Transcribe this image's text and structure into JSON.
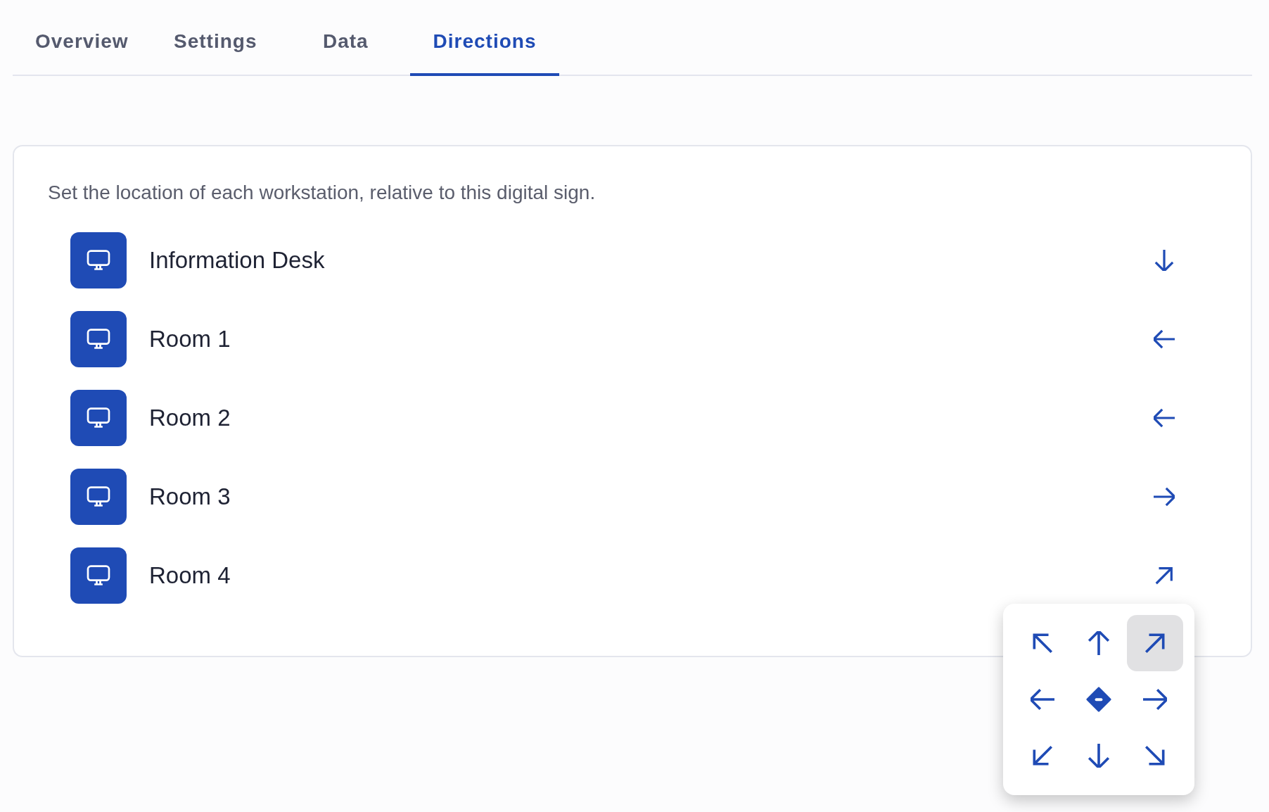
{
  "tabs": [
    {
      "label": "Overview",
      "selected": false
    },
    {
      "label": "Settings",
      "selected": false
    },
    {
      "label": "Data",
      "selected": false
    },
    {
      "label": "Directions",
      "selected": true
    }
  ],
  "description": "Set the location of each workstation, relative to this digital sign.",
  "rows": [
    {
      "name": "Information Desk",
      "kind": "down"
    },
    {
      "name": "Room 1",
      "kind": "left"
    },
    {
      "name": "Room 2",
      "kind": "left"
    },
    {
      "name": "Room 3",
      "kind": "right"
    },
    {
      "name": "Room 4",
      "kind": "up-right"
    }
  ],
  "direction_picker": {
    "cells": [
      {
        "kind": "up-left",
        "selected": false
      },
      {
        "kind": "up",
        "selected": false
      },
      {
        "kind": "up-right",
        "selected": true
      },
      {
        "kind": "left",
        "selected": false
      },
      {
        "kind": "center",
        "selected": false
      },
      {
        "kind": "right",
        "selected": false
      },
      {
        "kind": "down-left",
        "selected": false
      },
      {
        "kind": "down",
        "selected": false
      },
      {
        "kind": "down-right",
        "selected": false
      }
    ]
  }
}
